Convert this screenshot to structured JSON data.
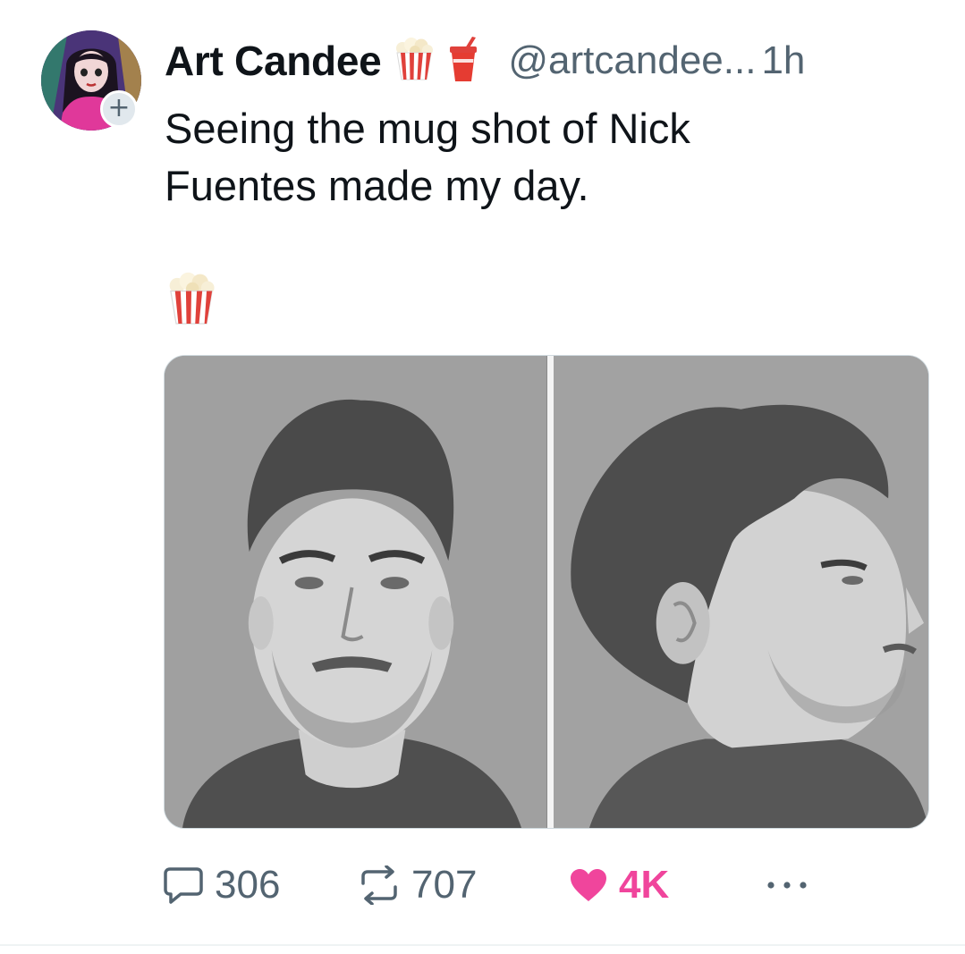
{
  "author": {
    "display_name": "Art Candee",
    "name_emojis": [
      "popcorn-icon",
      "cup-with-straw-icon"
    ],
    "handle": "@artcandee...",
    "time": "1h",
    "avatar_icon": "avatar-portrait-icon",
    "follow_badge": "+"
  },
  "tweet": {
    "text_line_1": "Seeing the mug shot of Nick",
    "text_line_2": "Fuentes made my day.",
    "trailing_emoji": "popcorn-icon"
  },
  "media": {
    "photos": [
      "front-view-photo",
      "side-profile-photo"
    ]
  },
  "actions": {
    "reply_count": "306",
    "retweet_count": "707",
    "like_count": "4K",
    "more_icon": "more-icon"
  },
  "colors": {
    "text_primary": "#0f1419",
    "text_secondary": "#536471",
    "like_pink": "#f0459c",
    "border": "#cfd9de"
  }
}
